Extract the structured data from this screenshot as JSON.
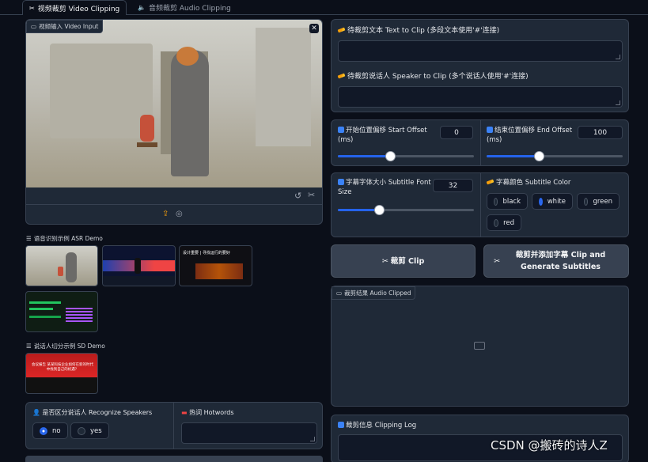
{
  "tabs": [
    {
      "label": "视频裁剪 Video Clipping",
      "active": true
    },
    {
      "label": "音频裁剪 Audio Clipping",
      "active": false
    }
  ],
  "video_input": {
    "label": "视频输入 Video Input"
  },
  "asr_demo": {
    "label": "语音识别示例 ASR Demo"
  },
  "sd_demo": {
    "label": "说话人切分示例 SD Demo"
  },
  "recognize_speakers": {
    "label": "是否区分说话人 Recognize Speakers",
    "options": [
      {
        "label": "no",
        "selected": true
      },
      {
        "label": "yes",
        "selected": false
      }
    ]
  },
  "hotwords": {
    "label": "热词 Hotwords",
    "value": ""
  },
  "text_to_clip": {
    "label": "待裁剪文本 Text to Clip (多段文本使用'#'连接)",
    "value": ""
  },
  "speaker_to_clip": {
    "label": "待裁剪说话人 Speaker to Clip (多个说话人使用'#'连接)",
    "value": ""
  },
  "start_offset": {
    "label": "开始位置偏移 Start Offset (ms)",
    "value": "0",
    "fraction": 0.5
  },
  "end_offset": {
    "label": "结束位置偏移 End Offset (ms)",
    "value": "100",
    "fraction": 0.5
  },
  "font_size": {
    "label": "字幕字体大小 Subtitle Font Size",
    "value": "32",
    "fraction": 0.26
  },
  "subtitle_color": {
    "label": "字幕颜色 Subtitle Color",
    "options": [
      {
        "label": "black",
        "selected": false
      },
      {
        "label": "white",
        "selected": true
      },
      {
        "label": "green",
        "selected": false
      },
      {
        "label": "red",
        "selected": false
      }
    ]
  },
  "buttons": {
    "clip": "裁剪 Clip",
    "clip_sub": "裁剪并添加字幕 Clip and Generate Subtitles"
  },
  "output": {
    "label": "裁剪结果 Audio Clipped"
  },
  "log": {
    "label": "裁剪信息 Clipping Log"
  },
  "watermark": "CSDN @搬砖的诗人Z",
  "demo_texts": {
    "t2_title": "设计重要 | 寻找运行的要好",
    "t5_text": "会议报告 某某科技企业如何在新的时代中找到自己的机遇？"
  },
  "colors": {
    "accent": "#2563eb",
    "background": "#0b0f19",
    "panel": "#1f2937"
  }
}
